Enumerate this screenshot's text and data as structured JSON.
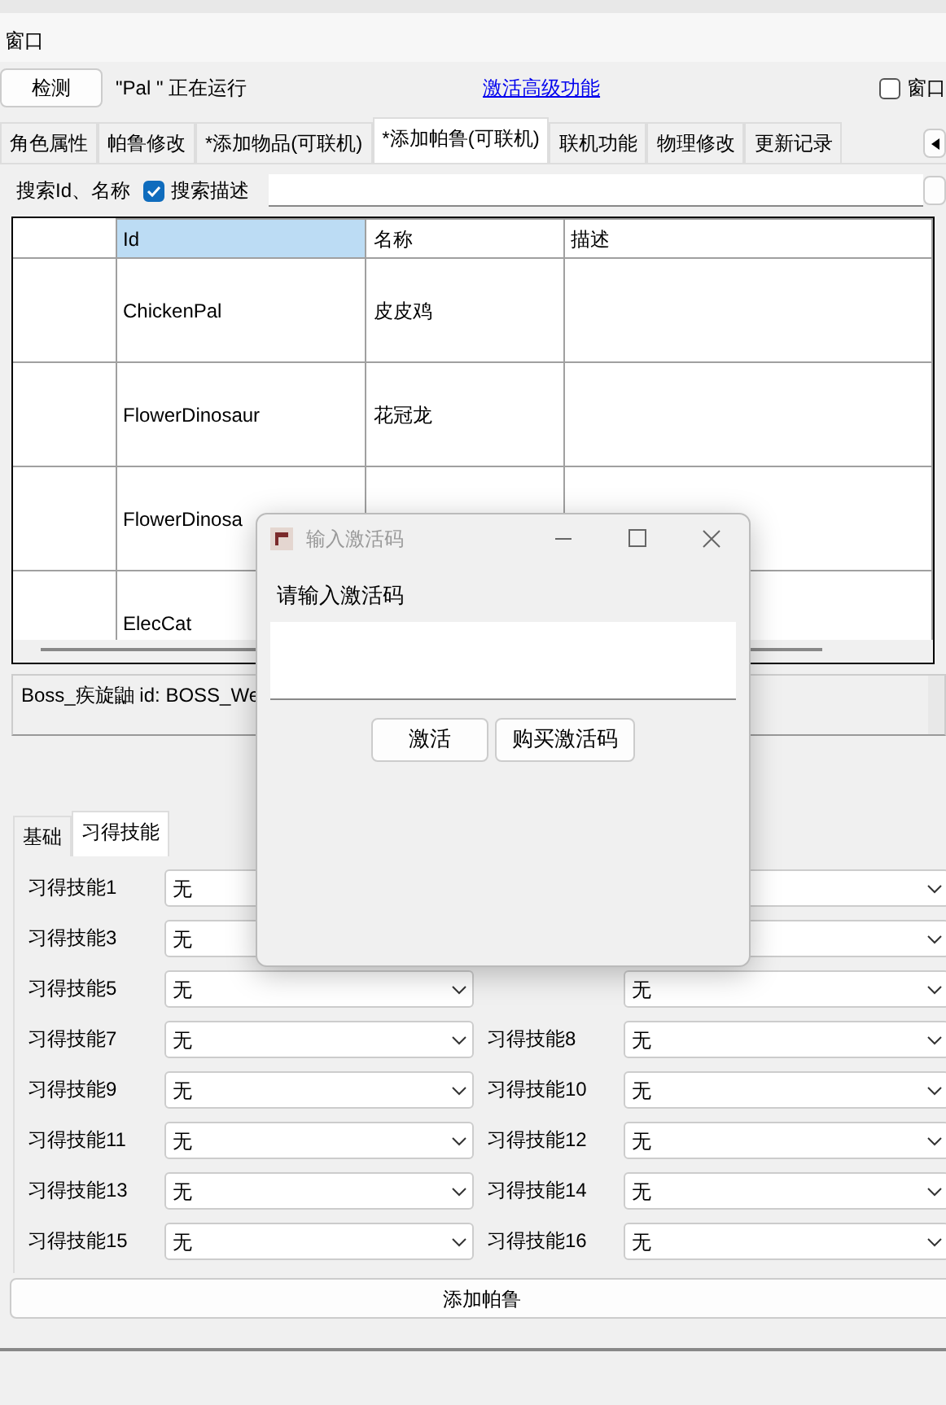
{
  "menu": [
    "窗口"
  ],
  "toolbar": {
    "detect_button": "检测",
    "status": "\"Pal   \" 正在运行",
    "activate_link": "激活高级功能",
    "topmost_checkbox": {
      "label": "窗口",
      "checked": false
    }
  },
  "tabs": [
    {
      "label": "角色属性",
      "selected": false
    },
    {
      "label": "帕鲁修改",
      "selected": false
    },
    {
      "label": "*添加物品(可联机)",
      "selected": false
    },
    {
      "label": "*添加帕鲁(可联机)",
      "selected": true
    },
    {
      "label": "联机功能",
      "selected": false
    },
    {
      "label": "物理修改",
      "selected": false
    },
    {
      "label": "更新记录",
      "selected": false
    }
  ],
  "search": {
    "label": "搜索Id、名称",
    "describe_checkbox": {
      "label": "搜索描述",
      "checked": true
    }
  },
  "table": {
    "columns": [
      {
        "label": "Id",
        "selected": true
      },
      {
        "label": "名称",
        "selected": false
      },
      {
        "label": "描述",
        "selected": false
      }
    ],
    "rows": [
      [
        "ChickenPal",
        "皮皮鸡"
      ],
      [
        "FlowerDinosaur",
        "花冠龙"
      ],
      [
        "FlowerDinosa"
      ],
      [
        "ElecCat"
      ]
    ]
  },
  "description": "Boss_疾旋鼬 id: BOSS_We",
  "sub_tabs": [
    {
      "label": "基础",
      "selected": false
    },
    {
      "label": "习得技能",
      "selected": true
    }
  ],
  "skills": [
    {
      "left": {
        "label": "习得技能1",
        "value": "无"
      }
    },
    {
      "left": {
        "label": "习得技能3",
        "value": "无"
      }
    },
    {
      "left": {
        "label": "习得技能5",
        "value": "无"
      },
      "right": {
        "value": "无"
      }
    },
    {
      "left": {
        "label": "习得技能7",
        "value": "无"
      },
      "right": {
        "label": "习得技能8",
        "value": "无"
      }
    },
    {
      "left": {
        "label": "习得技能9",
        "value": "无"
      },
      "right": {
        "label": "习得技能10",
        "value": "无"
      }
    },
    {
      "left": {
        "label": "习得技能11",
        "value": "无"
      },
      "right": {
        "label": "习得技能12",
        "value": "无"
      }
    },
    {
      "left": {
        "label": "习得技能13",
        "value": "无"
      },
      "right": {
        "label": "习得技能14",
        "value": "无"
      }
    },
    {
      "left": {
        "label": "习得技能15",
        "value": "无"
      },
      "right": {
        "label": "习得技能16",
        "value": "无"
      }
    }
  ],
  "add_button": "添加帕鲁",
  "dialog": {
    "title": "输入激活码",
    "prompt": "请输入激活码",
    "buttons": [
      "激活",
      "购买激活码"
    ]
  }
}
